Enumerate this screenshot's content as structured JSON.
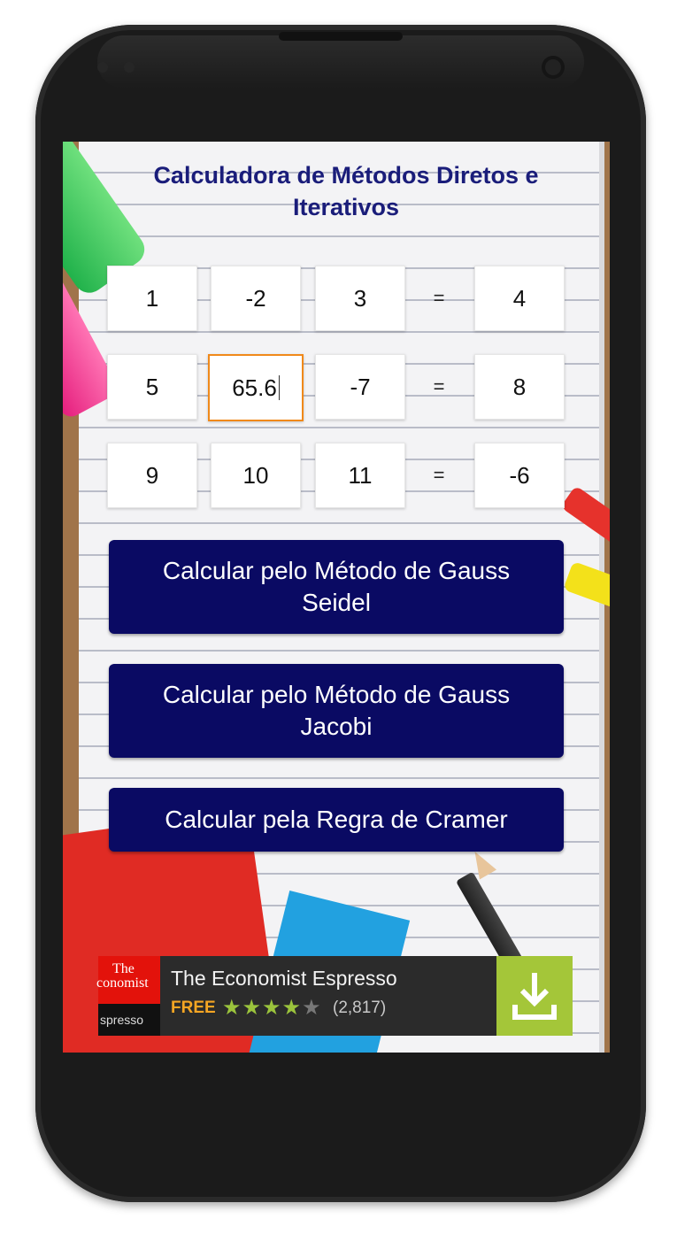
{
  "app": {
    "title": "Calculadora de Métodos Diretos e Iterativos"
  },
  "matrix": {
    "rows": [
      {
        "a": "1",
        "b": "-2",
        "c": "3",
        "eq": "=",
        "result": "4"
      },
      {
        "a": "5",
        "b": "65.6",
        "c": "-7",
        "eq": "=",
        "result": "8"
      },
      {
        "a": "9",
        "b": "10",
        "c": "11",
        "eq": "=",
        "result": "-6"
      }
    ],
    "focused_cell": "row2-b"
  },
  "buttons": {
    "gauss_seidel": "Calcular pelo Método de Gauss Seidel",
    "gauss_jacobi": "Calcular pelo Método de Gauss Jacobi",
    "cramer": "Calcular pela Regra de Cramer"
  },
  "ad": {
    "logo_line1": "The",
    "logo_line2": "conomist",
    "logo_line3": "spresso",
    "title": "The Economist Espresso",
    "price": "FREE",
    "stars_filled": "★★★★",
    "stars_empty": "★",
    "rating_count": "(2,817)",
    "stars_value": 4.5
  },
  "colors": {
    "title": "#1a1d7a",
    "button_bg": "#0a0a63",
    "focus_border": "#f0891a",
    "ad_accent": "#a4c639",
    "ad_free": "#f6a623"
  }
}
